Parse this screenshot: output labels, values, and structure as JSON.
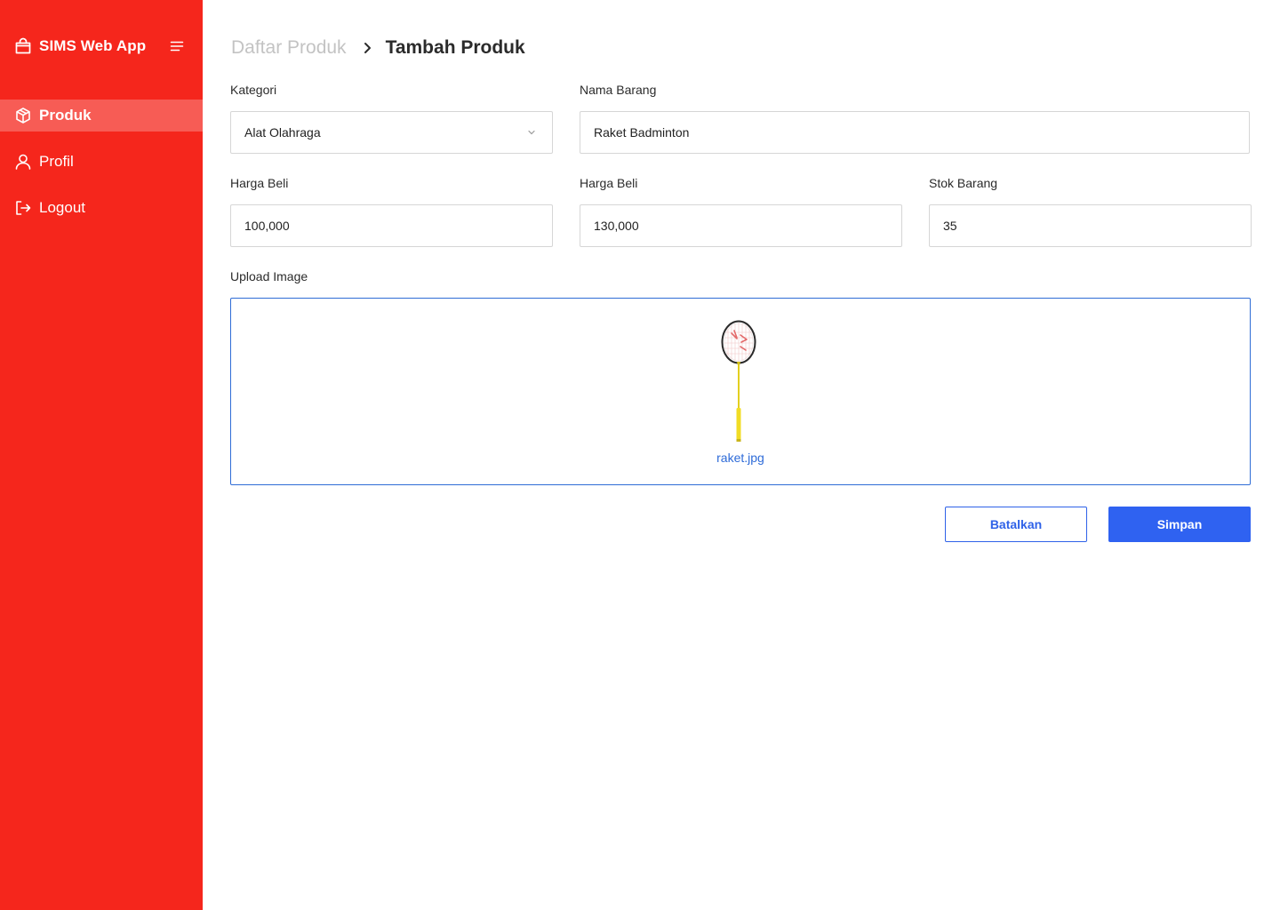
{
  "app": {
    "title": "SIMS Web App",
    "brand_color": "#f5261c",
    "accent_color": "#2f62f1"
  },
  "sidebar": {
    "items": [
      {
        "label": "Produk",
        "icon": "cube-icon",
        "active": true
      },
      {
        "label": "Profil",
        "icon": "user-icon",
        "active": false
      },
      {
        "label": "Logout",
        "icon": "logout-icon",
        "active": false
      }
    ]
  },
  "breadcrumb": {
    "parent": "Daftar Produk",
    "current": "Tambah Produk"
  },
  "form": {
    "kategori": {
      "label": "Kategori",
      "value": "Alat Olahraga"
    },
    "nama_barang": {
      "label": "Nama Barang",
      "value": "Raket Badminton"
    },
    "harga_beli": {
      "label": "Harga Beli",
      "value": "100,000"
    },
    "harga_jual": {
      "label": "Harga Beli",
      "value": "130,000"
    },
    "stok_barang": {
      "label": "Stok Barang",
      "value": "35"
    },
    "upload": {
      "label": "Upload Image",
      "file_name": "raket.jpg"
    }
  },
  "actions": {
    "cancel_label": "Batalkan",
    "save_label": "Simpan"
  }
}
